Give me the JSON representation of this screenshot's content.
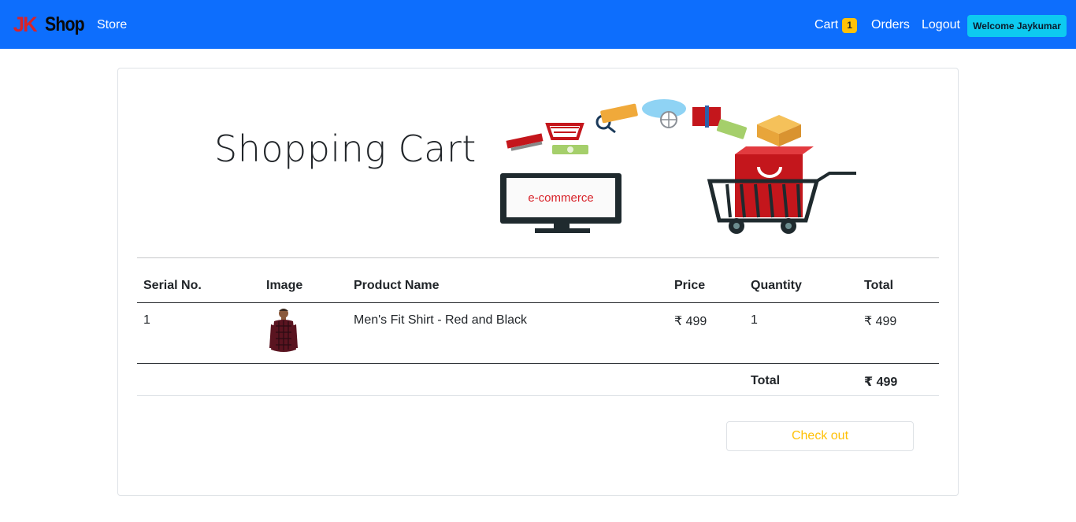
{
  "navbar": {
    "brand_jk": "JK",
    "brand_shop": "Shop",
    "store_label": "Store",
    "cart_label": "Cart",
    "cart_count": "1",
    "orders_label": "Orders",
    "logout_label": "Logout",
    "welcome_label": "Welcome Jaykumar"
  },
  "page": {
    "title": "Shopping Cart",
    "hero_screen_text": "e-commerce"
  },
  "table": {
    "headers": [
      "Serial No.",
      "Image",
      "Product Name",
      "Price",
      "Quantity",
      "Total"
    ],
    "rows": [
      {
        "serial": "1",
        "name": "Men's Fit Shirt - Red and Black",
        "price": "₹ 499",
        "quantity": "1",
        "total": "₹ 499"
      }
    ],
    "footer": {
      "label": "Total",
      "amount": "₹ 499"
    }
  },
  "checkout_label": "Check out",
  "colors": {
    "navbar": "#0d6efd",
    "badge": "#ffc107",
    "welcome": "#0dcaf0",
    "checkout_text": "#ffc107"
  }
}
